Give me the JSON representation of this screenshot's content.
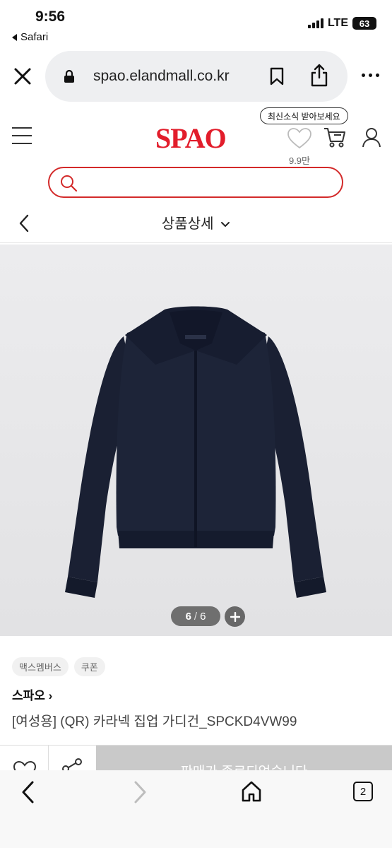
{
  "status_bar": {
    "time": "9:56",
    "back_app": "Safari",
    "network": "LTE",
    "battery": "63"
  },
  "browser": {
    "url": "spao.elandmall.co.kr",
    "tab_count": "2"
  },
  "header": {
    "logo": "SPAO",
    "tooltip": "최신소식 받아보세요",
    "wish_count": "9.9만"
  },
  "search": {
    "placeholder": ""
  },
  "subnav": {
    "title": "상품상세"
  },
  "gallery": {
    "current": "6",
    "total": "6"
  },
  "product": {
    "tags": [
      "맥스멤버스",
      "쿠폰"
    ],
    "brand": "스파오 ›",
    "name": "[여성용] (QR) 카라넥 집업 가디건_SPCKD4VW99"
  },
  "purchase_bar": {
    "soldout_label": "판매가 종료되었습니다"
  },
  "colors": {
    "brand_red": "#e21d2b",
    "search_border": "#d32a2a",
    "cardigan_navy": "#1b2236"
  }
}
